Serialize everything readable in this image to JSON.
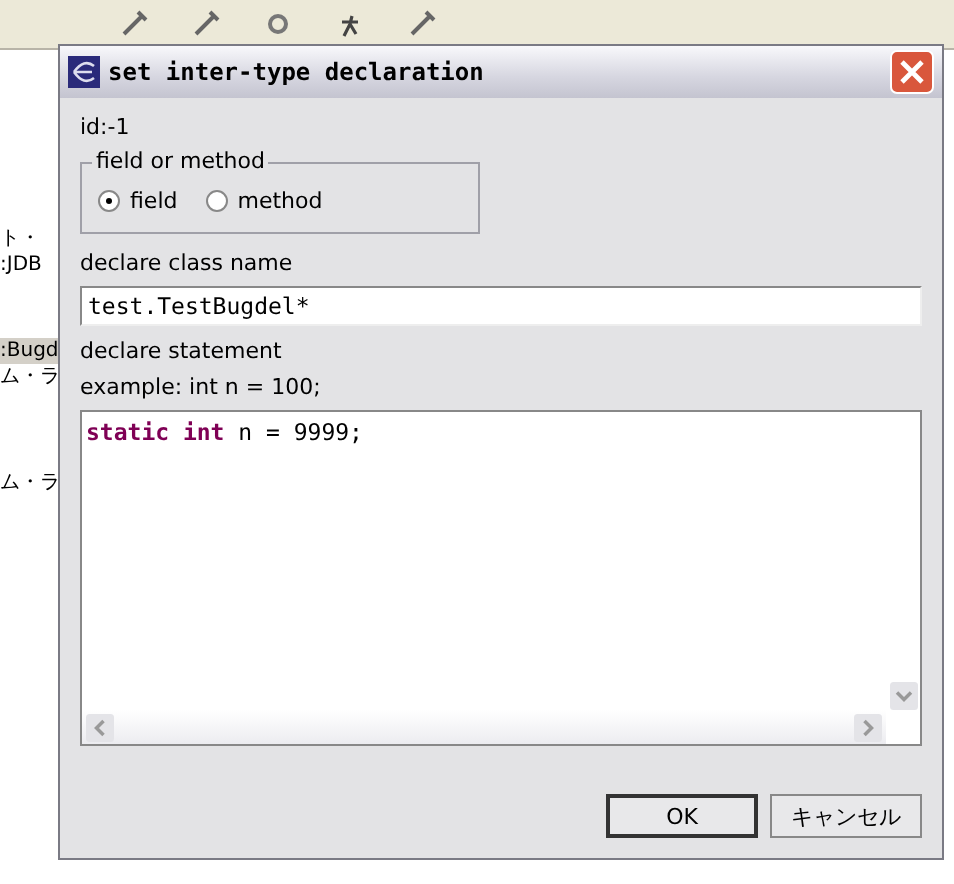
{
  "background": {
    "fragments": [
      {
        "text": "ト・",
        "selected": false
      },
      {
        "text": ":JDB",
        "selected": false
      },
      {
        "text": ":Bugd",
        "selected": true
      },
      {
        "text": "ム・ラ",
        "selected": false
      },
      {
        "text": "ム・ラ",
        "selected": false
      }
    ]
  },
  "window": {
    "title": "set inter-type declaration"
  },
  "dialog": {
    "id_label": "id:-1",
    "group": {
      "title": "field or method",
      "options": [
        {
          "label": "field",
          "selected": true
        },
        {
          "label": "method",
          "selected": false
        }
      ]
    },
    "class_name": {
      "label": "declare class name",
      "value": "test.TestBugdel*"
    },
    "statement": {
      "label": "declare statement",
      "hint": "example: int n = 100;",
      "code": [
        {
          "text": "static int",
          "kind": "keyword"
        },
        {
          "text": " n = 9999;",
          "kind": "plain"
        }
      ]
    },
    "buttons": [
      {
        "label": "OK",
        "default": true
      },
      {
        "label": "キャンセル",
        "default": false
      }
    ]
  }
}
